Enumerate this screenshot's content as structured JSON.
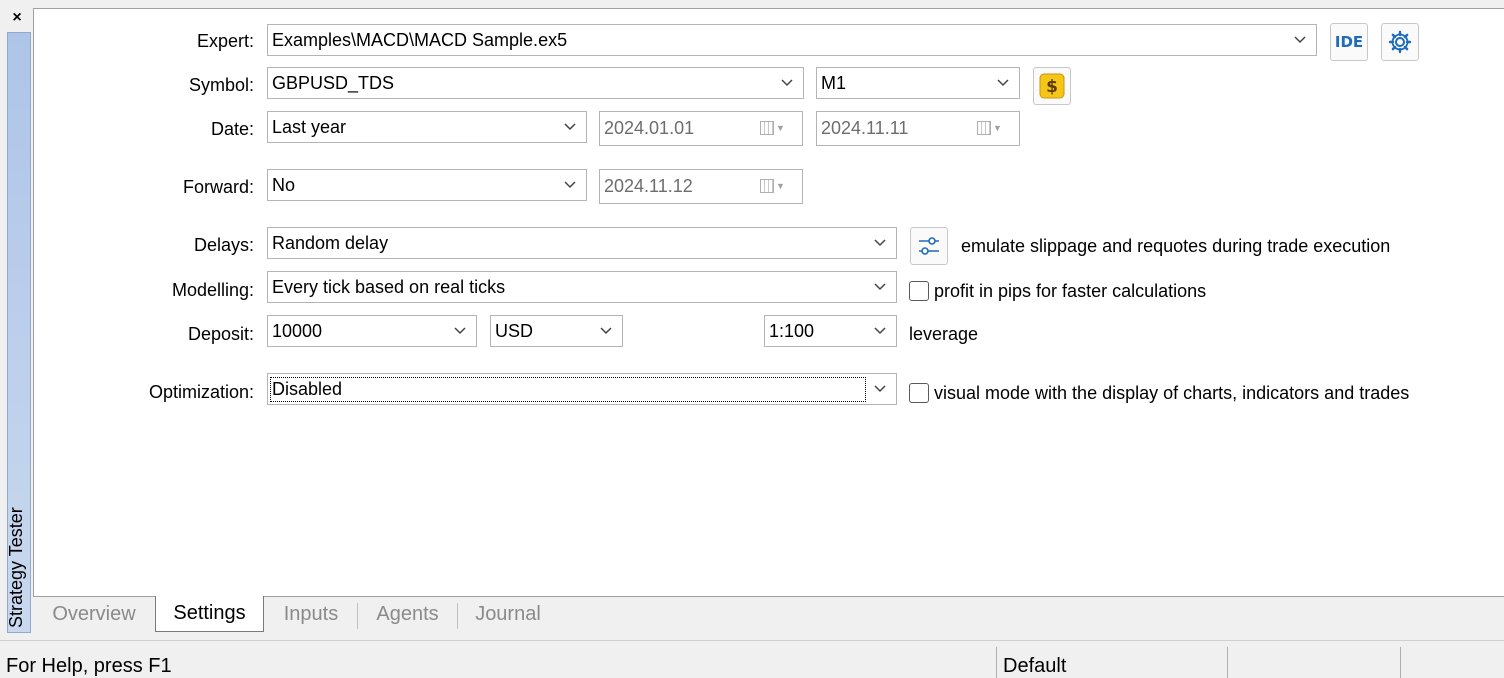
{
  "window": {
    "close_glyph": "×",
    "side_tab_label": "Strategy Tester"
  },
  "form": {
    "expert": {
      "label": "Expert:",
      "value": "Examples\\MACD\\MACD Sample.ex5",
      "ide_button": "IDE"
    },
    "symbol": {
      "label": "Symbol:",
      "value": "GBPUSD_TDS",
      "timeframe": "M1"
    },
    "date": {
      "label": "Date:",
      "range": "Last year",
      "from": "2024.01.01",
      "to": "2024.11.11"
    },
    "forward": {
      "label": "Forward:",
      "value": "No",
      "date": "2024.11.12"
    },
    "delays": {
      "label": "Delays:",
      "value": "Random delay",
      "note": "emulate slippage and requotes during trade execution"
    },
    "modelling": {
      "label": "Modelling:",
      "value": "Every tick based on real ticks",
      "checkbox_label": "profit in pips for faster calculations",
      "checked": false
    },
    "deposit": {
      "label": "Deposit:",
      "amount": "10000",
      "currency": "USD",
      "leverage": "1:100",
      "leverage_label": "leverage"
    },
    "optimization": {
      "label": "Optimization:",
      "value": "Disabled",
      "checkbox_label": "visual mode with the display of charts, indicators and trades",
      "checked": false
    }
  },
  "tabs": [
    {
      "label": "Overview",
      "active": false
    },
    {
      "label": "Settings",
      "active": true
    },
    {
      "label": "Inputs",
      "active": false
    },
    {
      "label": "Agents",
      "active": false
    },
    {
      "label": "Journal",
      "active": false
    }
  ],
  "status_bar": {
    "help": "For Help, press F1",
    "profile": "Default"
  },
  "colors": {
    "accent": "#1e6bb8",
    "side_tab": "#aec5e8",
    "dollar_icon": "#f5c518"
  },
  "icons": [
    "close-icon",
    "chevron-down-icon",
    "calendar-icon",
    "gear-icon",
    "dollar-icon",
    "sliders-icon"
  ]
}
